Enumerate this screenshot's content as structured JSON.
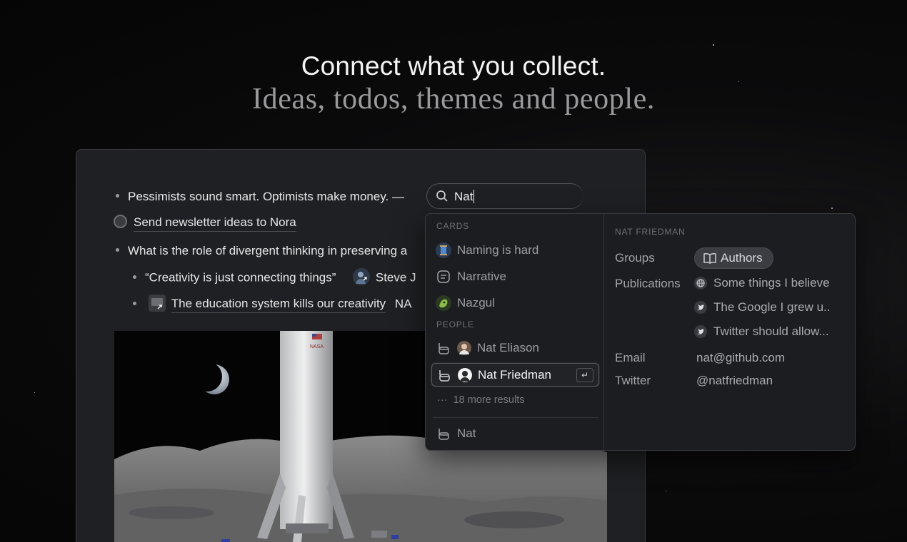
{
  "hero": {
    "title": "Connect what you collect.",
    "subtitle": "Ideas, todos, themes and people."
  },
  "editor": {
    "lines": [
      {
        "text": "Pessimists sound smart. Optimists make money. —",
        "type": "bullet"
      },
      {
        "text": "Send newsletter ideas to Nora",
        "type": "todo"
      },
      {
        "text": "What is the role of divergent thinking in preserving a",
        "type": "bullet"
      },
      {
        "text": "“Creativity is just connecting things”",
        "type": "sub-bullet",
        "tag": "Steve J"
      },
      {
        "text": "The education system kills our creativity",
        "type": "sub-bullet",
        "tag": "NA"
      }
    ]
  },
  "search": {
    "query": "Nat"
  },
  "dropdown": {
    "cards_label": "CARDS",
    "cards": [
      {
        "label": "Naming is hard",
        "icon": "spool-icon"
      },
      {
        "label": "Narrative",
        "icon": "document-icon"
      },
      {
        "label": "Nazgul",
        "icon": "nazgul-icon"
      }
    ],
    "people_label": "PEOPLE",
    "people": [
      {
        "label": "Nat Eliason",
        "icon": "person-avatar"
      },
      {
        "label": "Nat Friedman",
        "icon": "person-avatar",
        "selected": true
      }
    ],
    "more_results": "18 more results",
    "create_label": "Nat",
    "enter_symbol": "↵"
  },
  "detail": {
    "title": "NAT FRIEDMAN",
    "groups_label": "Groups",
    "group": "Authors",
    "publications_label": "Publications",
    "publications": [
      {
        "text": "Some things I believe",
        "icon": "globe-icon"
      },
      {
        "text": "The Google I grew u..",
        "icon": "twitter-icon"
      },
      {
        "text": "Twitter should allow...",
        "icon": "twitter-icon"
      }
    ],
    "email_label": "Email",
    "email": "nat@github.com",
    "twitter_label": "Twitter",
    "twitter": "@natfriedman"
  },
  "colors": {
    "background": "#050505",
    "panel": "#1f2023",
    "dropdown": "#1c1d20",
    "text": "#e7e7e9",
    "muted": "#9c9da1"
  }
}
